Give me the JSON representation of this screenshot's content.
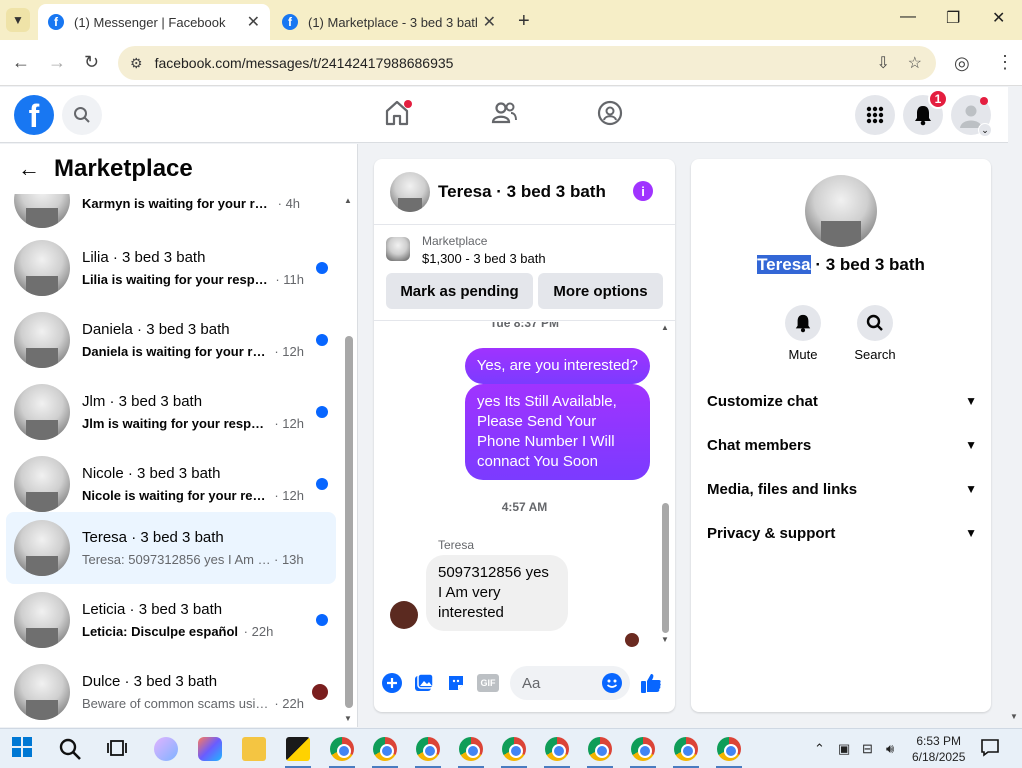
{
  "browser": {
    "tabs": [
      {
        "title": "(1) Messenger | Facebook",
        "active": true
      },
      {
        "title": "(1) Marketplace - 3 bed 3 bath |",
        "active": false
      }
    ],
    "url": "facebook.com/messages/t/24142417988686935"
  },
  "fb_header": {
    "notification_count": "1",
    "accent_color": "#1877f2"
  },
  "sidebar": {
    "title": "Marketplace",
    "conversations": [
      {
        "name": "",
        "snippet": "Karmyn is waiting for your resp...",
        "time": "· 4h",
        "unread": true,
        "indicator": "dot"
      },
      {
        "name": "Lilia · 3 bed 3 bath",
        "snippet": "Lilia is waiting for your respon...",
        "time": "· 11h",
        "unread": true,
        "indicator": "dot"
      },
      {
        "name": "Daniela · 3 bed 3 bath",
        "snippet": "Daniela is waiting for your res...",
        "time": "· 12h",
        "unread": true,
        "indicator": "dot"
      },
      {
        "name": "Jlm · 3 bed 3 bath",
        "snippet": "Jlm is waiting for your response.",
        "time": "· 12h",
        "unread": true,
        "indicator": "dot"
      },
      {
        "name": "Nicole · 3 bed 3 bath",
        "snippet": "Nicole is waiting for your resp...",
        "time": "· 12h",
        "unread": true,
        "indicator": "dot"
      },
      {
        "name": "Teresa · 3 bed 3 bath",
        "snippet": "Teresa: 5097312856 yes I Am very ...",
        "time": "· 13h",
        "unread": false,
        "indicator": "none"
      },
      {
        "name": "Leticia · 3 bed 3 bath",
        "snippet": "Leticia: Disculpe español",
        "time": "· 22h",
        "unread": true,
        "indicator": "dot"
      },
      {
        "name": "Dulce · 3 bed 3 bath",
        "snippet": "Beware of common scams usin...",
        "time": "· 22h",
        "unread": false,
        "indicator": "avatar"
      }
    ]
  },
  "chat": {
    "title": "Teresa · 3 bed 3 bath",
    "listing_label": "Marketplace",
    "listing_price": "$1,300 - 3 bed 3 bath",
    "mark_pending_label": "Mark as pending",
    "more_options_label": "More options",
    "messages": {
      "timestamp_1": "Tue 8:37 PM",
      "out_1": "Yes, are you interested?",
      "out_2": "yes Its Still Available, Please Send Your Phone Number I Will connact You Soon",
      "timestamp_2": "4:57 AM",
      "sender": "Teresa",
      "in_1": "5097312856 yes I Am very interested"
    },
    "composer_placeholder": "Aa",
    "gif_label": "GIF"
  },
  "info_panel": {
    "name_highlight": "Teresa",
    "name_rest": " · 3 bed 3 bath",
    "mute_label": "Mute",
    "search_label": "Search",
    "sections": [
      "Customize chat",
      "Chat members",
      "Media, files and links",
      "Privacy & support"
    ]
  },
  "taskbar": {
    "time": "6:53 PM",
    "date": "6/18/2025"
  }
}
